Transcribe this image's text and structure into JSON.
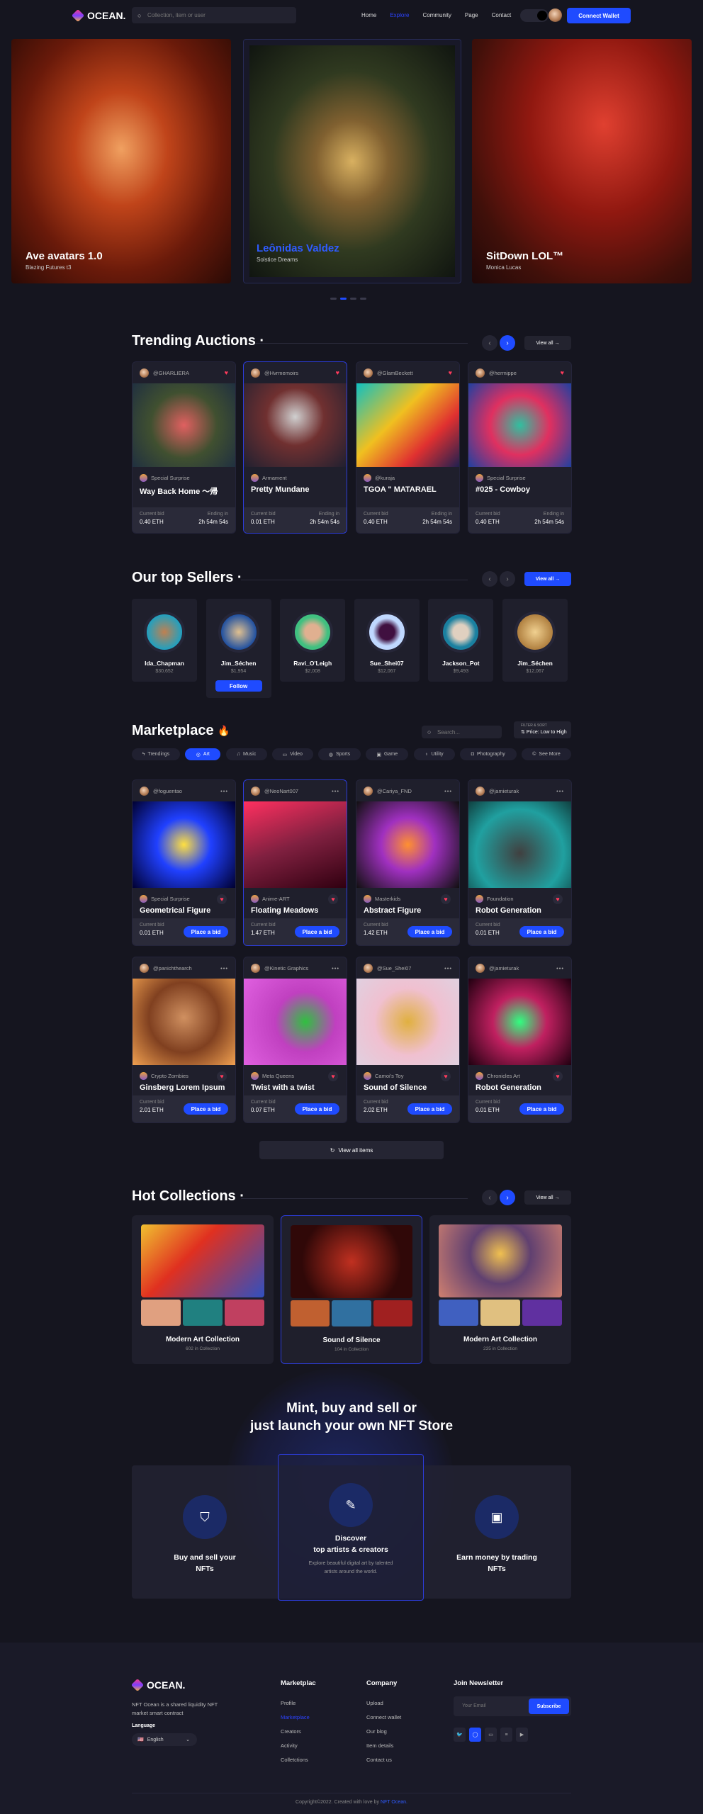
{
  "nav": {
    "brand": "OCEAN.",
    "search_placeholder": "Collection, item or user",
    "links": [
      "Home",
      "Explore",
      "Community",
      "Page",
      "Contact"
    ],
    "active": "Explore",
    "connect_wallet": "Connect Wallet"
  },
  "hero": [
    {
      "title": "Ave avatars 1.0",
      "subtitle": "Blazing Futures t3"
    },
    {
      "title": "Leônidas Valdez",
      "subtitle": "Solstice Dreams"
    },
    {
      "title": "SitDown LOL™",
      "subtitle": "Monica Lucas"
    }
  ],
  "carousel": {
    "slides": 4,
    "active": 2
  },
  "colors": {
    "accent": "#1f4bff",
    "background": "#15151f",
    "card": "#1f1f2c",
    "heart": "#ff3b5c"
  },
  "trending": {
    "title": "Trending Auctions",
    "view_all": "View all →",
    "bid_label": "Current bid",
    "ending_label": "Ending in",
    "items": [
      {
        "user": "@GHARLIERA",
        "category": "Special Surprise",
        "name": "Way Back Home 〜帰",
        "bid": "0.40 ETH",
        "time": "2h  54m  54s"
      },
      {
        "user": "@Hvrmemoirs",
        "category": "Armament",
        "name": "Pretty Mundane",
        "bid": "0.01 ETH",
        "time": "2h  54m  54s"
      },
      {
        "user": "@GlamBeckett",
        "category": "@kuraja",
        "name": "TGOA \" MATARAEL",
        "bid": "0.40 ETH",
        "time": "2h  54m  54s"
      },
      {
        "user": "@hermippe",
        "category": "Special Surprise",
        "name": "#025 - Cowboy",
        "bid": "0.40 ETH",
        "time": "2h  54m  54s"
      }
    ]
  },
  "sellers": {
    "title": "Our top Sellers",
    "view_all": "View all →",
    "follow": "Follow",
    "items": [
      {
        "name": "Ida_Chapman",
        "value": "$30,652"
      },
      {
        "name": "Jim_Séchen",
        "value": "$1,954"
      },
      {
        "name": "Ravi_O'Leigh",
        "value": "$2,008"
      },
      {
        "name": "Sue_Shei07",
        "value": "$12,067"
      },
      {
        "name": "Jackson_Pot",
        "value": "$9,493"
      },
      {
        "name": "Jim_Séchen",
        "value": "$12,067"
      }
    ]
  },
  "marketplace": {
    "title": "Marketplace",
    "emoji": "🔥",
    "search_placeholder": "Search...",
    "filter_label": "FILTER & SORT",
    "sort": "Price: Low to High",
    "categories": [
      "Trendings",
      "Art",
      "Music",
      "Video",
      "Sports",
      "Game",
      "Utility",
      "Photography",
      "See More"
    ],
    "active_category": "Art",
    "bid_label": "Current bid",
    "place_bid": "Place a bid",
    "view_all_items": "View all items",
    "items": [
      {
        "user": "@foguentao",
        "category": "Special Surprise",
        "name": "Geometrical Figure",
        "bid": "0.01 ETH"
      },
      {
        "user": "@NeoNart007",
        "category": "Anime-ART",
        "name": "Floating Meadows",
        "bid": "1.47 ETH"
      },
      {
        "user": "@Cariya_FND",
        "category": "Masterkids",
        "name": "Abstract Figure",
        "bid": "1.42 ETH"
      },
      {
        "user": "@jamieturak",
        "category": "Foundation",
        "name": "Robot Generation",
        "bid": "0.01 ETH"
      },
      {
        "user": "@panichthearch",
        "category": "Crypto Zombies",
        "name": "Ginsberg Lorem Ipsum",
        "bid": "2.01 ETH"
      },
      {
        "user": "@Kinetic Graphics",
        "category": "Meta Queens",
        "name": "Twist with a twist",
        "bid": "0.07 ETH"
      },
      {
        "user": "@Sue_Shei07",
        "category": "Camoi's Toy",
        "name": "Sound of Silence",
        "bid": "2.02 ETH"
      },
      {
        "user": "@jamieturak",
        "category": "Chronicles Art",
        "name": "Robot Generation",
        "bid": "0.01 ETH"
      }
    ]
  },
  "collections": {
    "title": "Hot Collections",
    "view_all": "View all →",
    "items": [
      {
        "name": "Modern Art Collection",
        "count": "602 in Collection"
      },
      {
        "name": "Sound of Silence",
        "count": "104 in Collection"
      },
      {
        "name": "Modern Art Collection",
        "count": "235 in Collection"
      }
    ]
  },
  "promo": {
    "line1": "Mint, buy and sell or",
    "line2": "just launch your own NFT Store",
    "features": [
      {
        "title1": "Buy and sell your",
        "title2": "NFTs",
        "desc1": "",
        "desc2": ""
      },
      {
        "title1": "Discover",
        "title2": "top artists & creators",
        "desc1": "Explore beautiful digital art by talented",
        "desc2": "artists around the world."
      },
      {
        "title1": "Earn money by trading",
        "title2": "NFTs",
        "desc1": "",
        "desc2": ""
      }
    ]
  },
  "footer": {
    "brand": "OCEAN.",
    "desc1": "NFT Ocean is a shared liquidity NFT",
    "desc2": "market smart contract",
    "language_label": "Language",
    "language": "English",
    "col1": {
      "title": "Marketplac",
      "links": [
        "Profile",
        "Marketplace",
        "Creators",
        "Activity",
        "Colletctions"
      ],
      "active": "Marketplace"
    },
    "col2": {
      "title": "Company",
      "links": [
        "Upload",
        "Connect wallet",
        "Our blog",
        "Item details",
        "Contact us"
      ]
    },
    "newsletter": {
      "title": "Join Newsletter",
      "placeholder": "Your Email",
      "button": "Subscribe"
    },
    "social": [
      "twitter-icon",
      "github-icon",
      "tablet-icon",
      "database-icon",
      "youtube-icon"
    ],
    "copyright": "Copyright©2022. Created with love by ",
    "copyright_link": "NFT Ocean."
  }
}
